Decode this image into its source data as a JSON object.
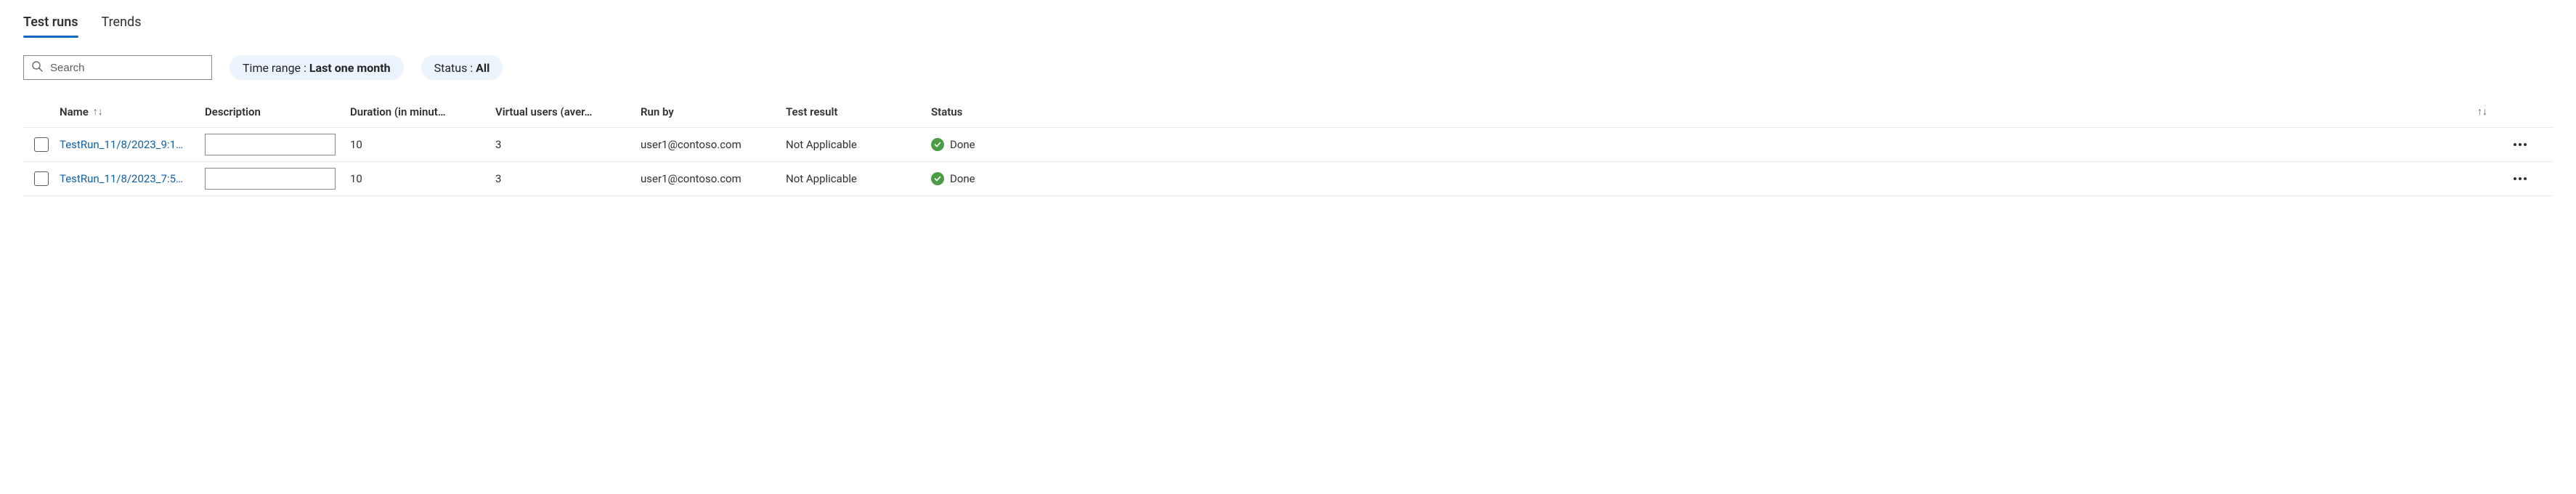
{
  "tabs": {
    "test_runs": "Test runs",
    "trends": "Trends",
    "active": "test_runs"
  },
  "filters": {
    "search_placeholder": "Search",
    "time_range": {
      "label": "Time range : ",
      "value": "Last one month"
    },
    "status": {
      "label": "Status : ",
      "value": "All"
    }
  },
  "columns": {
    "name": "Name",
    "description": "Description",
    "duration": "Duration (in minut…",
    "virtual_users": "Virtual users (aver…",
    "run_by": "Run by",
    "test_result": "Test result",
    "status": "Status"
  },
  "sort_glyph": "↑↓",
  "rows": [
    {
      "name": "TestRun_11/8/2023_9:1…",
      "description": "",
      "duration": "10",
      "virtual_users": "3",
      "run_by": "user1@contoso.com",
      "test_result": "Not Applicable",
      "status": "Done"
    },
    {
      "name": "TestRun_11/8/2023_7:5…",
      "description": "",
      "duration": "10",
      "virtual_users": "3",
      "run_by": "user1@contoso.com",
      "test_result": "Not Applicable",
      "status": "Done"
    }
  ]
}
